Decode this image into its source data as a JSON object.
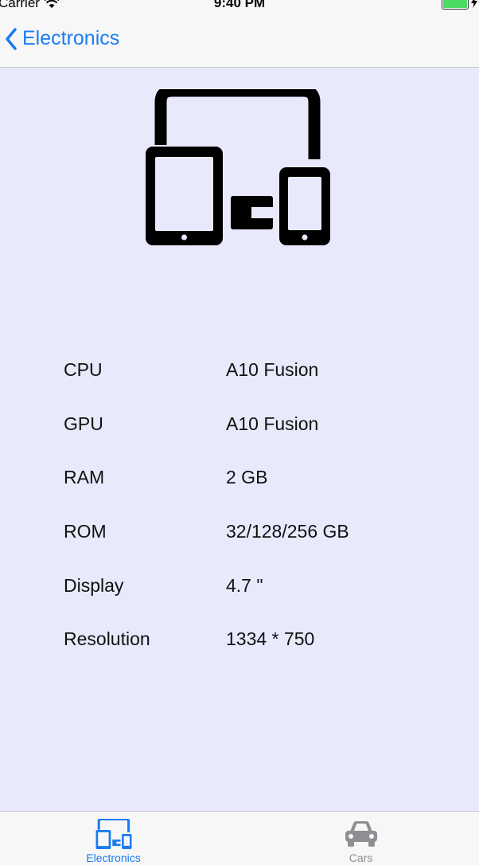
{
  "status_bar": {
    "carrier": "Carrier",
    "time": "9:40 PM"
  },
  "nav": {
    "back_label": "Electronics"
  },
  "hero_icon": "devices-icon",
  "specs": [
    {
      "label": "CPU",
      "value": "A10 Fusion"
    },
    {
      "label": "GPU",
      "value": "A10 Fusion"
    },
    {
      "label": "RAM",
      "value": "2 GB"
    },
    {
      "label": "ROM",
      "value": "32/128/256 GB"
    },
    {
      "label": "Display",
      "value": "4.7 \""
    },
    {
      "label": "Resolution",
      "value": "1334 * 750"
    }
  ],
  "tabs": [
    {
      "label": "Electronics",
      "icon": "devices-icon",
      "selected": true
    },
    {
      "label": "Cars",
      "icon": "car-icon",
      "selected": false
    }
  ],
  "colors": {
    "accent": "#1a7cf0",
    "background": "#e8eafc",
    "bar": "#f7f7f8",
    "inactive": "#8e8e93",
    "battery": "#4cd964"
  }
}
